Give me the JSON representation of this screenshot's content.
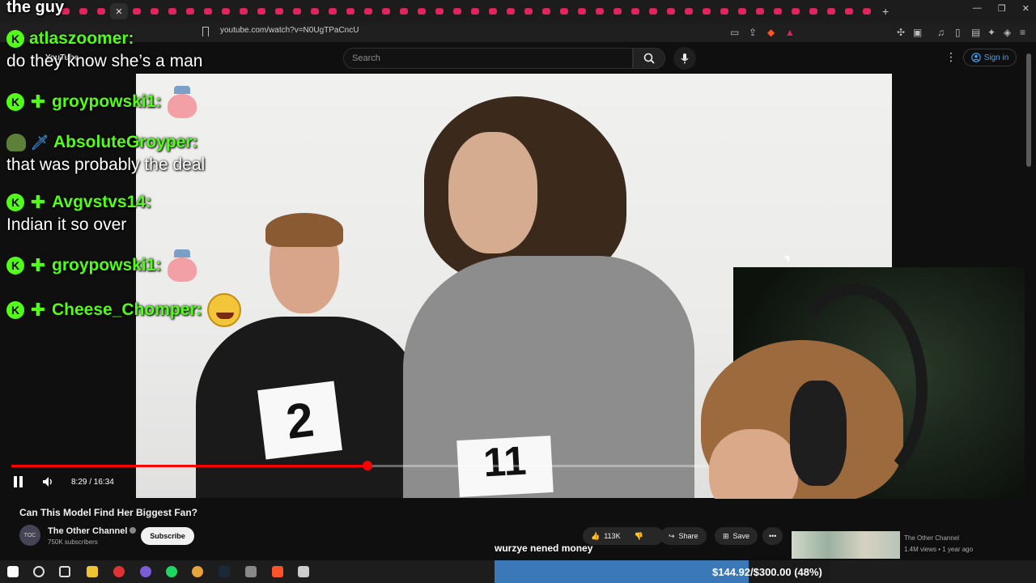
{
  "browser": {
    "url": "youtube.com/watch?v=N0UgTPaCncU",
    "tab_count": 46
  },
  "youtube": {
    "logo_text": "YouTube",
    "search_placeholder": "Search",
    "sign_in_label": "Sign in"
  },
  "video": {
    "time_current": "8:29",
    "time_total": "16:34",
    "time_display": "8:29 / 16:34",
    "progress": 0.512,
    "bib_left": "2",
    "bib_right": "11"
  },
  "chat": {
    "top_fragment": "the guy",
    "messages": [
      {
        "user": "atlaszoomer:",
        "text": "do they know she’s a man",
        "badges": [
          "k"
        ],
        "emote": null
      },
      {
        "user": "groypowski1:",
        "text": "",
        "badges": [
          "k",
          "plus"
        ],
        "emote": "pink-emote"
      },
      {
        "user": "AbsoluteGroyper:",
        "text": "that was probably the deal",
        "badges": [
          "helmet",
          "sword"
        ],
        "emote": null
      },
      {
        "user": "Avgvstvs14:",
        "text": "Indian it so over",
        "badges": [
          "k",
          "plus"
        ],
        "emote": null
      },
      {
        "user": "groypowski1:",
        "text": "",
        "badges": [
          "k",
          "plus"
        ],
        "emote": "pink-emote"
      },
      {
        "user": "Cheese_Chomper:",
        "text": "",
        "badges": [
          "k",
          "plus"
        ],
        "emote": "laugh-emote"
      }
    ]
  },
  "info": {
    "title": "Can This Model Find Her Biggest Fan?",
    "channel_name": "The Other Channel",
    "avatar_text": "TOC",
    "subscribers": "750K subscribers",
    "subscribe_label": "Subscribe",
    "likes": "113K",
    "share_label": "Share",
    "save_label": "Save",
    "caption": "wurzye nened money",
    "rec_channel": "The Other Channel",
    "rec_meta": "1.4M views • 1 year ago"
  },
  "stream": {
    "donation_text": "$144.92/$300.00 (48%)",
    "donation_progress": 0.48
  },
  "colors": {
    "kick_green": "#53fc18",
    "yt_red": "#ff0000",
    "link_blue": "#3ea6ff",
    "donation_blue": "#3b78b8"
  }
}
